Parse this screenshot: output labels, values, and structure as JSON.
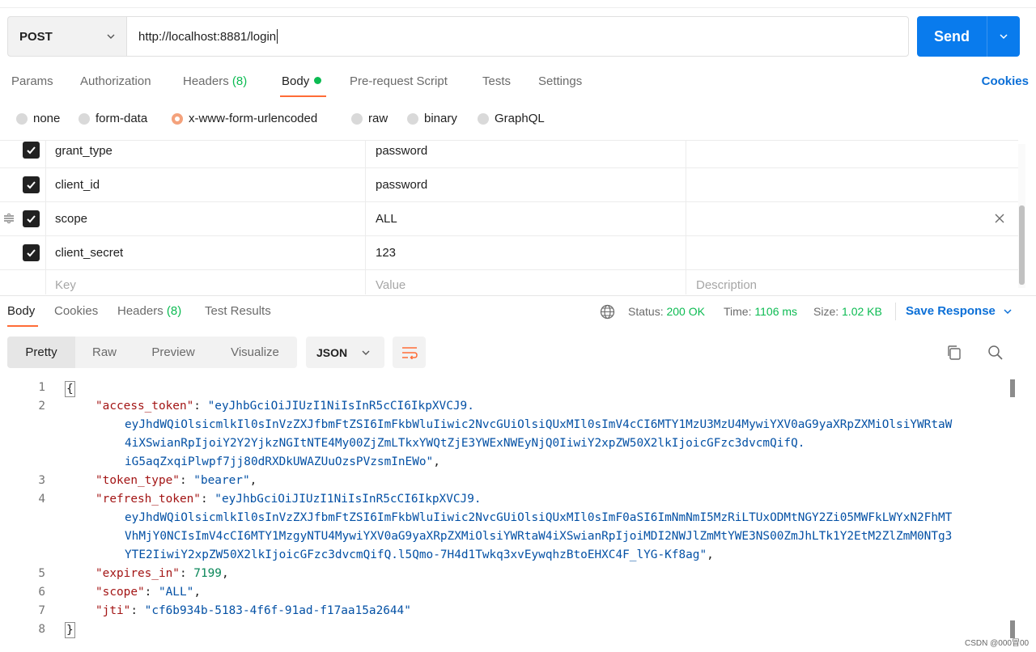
{
  "request": {
    "method": "POST",
    "url": "http://localhost:8881/login",
    "send_label": "Send"
  },
  "request_tabs": {
    "params": "Params",
    "authorization": "Authorization",
    "headers": "Headers",
    "headers_count": "(8)",
    "body": "Body",
    "prerequest": "Pre-request Script",
    "tests": "Tests",
    "settings": "Settings",
    "cookies": "Cookies"
  },
  "body_types": [
    "none",
    "form-data",
    "x-www-form-urlencoded",
    "raw",
    "binary",
    "GraphQL"
  ],
  "body_type_selected": "x-www-form-urlencoded",
  "form_rows": [
    {
      "key": "grant_type",
      "value": "password",
      "checked": true
    },
    {
      "key": "client_id",
      "value": "password",
      "checked": true
    },
    {
      "key": "scope",
      "value": "ALL",
      "checked": true
    },
    {
      "key": "client_secret",
      "value": "123",
      "checked": true
    }
  ],
  "form_placeholders": {
    "key": "Key",
    "value": "Value",
    "description": "Description"
  },
  "response_tabs": {
    "body": "Body",
    "cookies": "Cookies",
    "headers": "Headers",
    "headers_count": "(8)",
    "test_results": "Test Results"
  },
  "response_meta": {
    "status_label": "Status:",
    "status_value": "200 OK",
    "time_label": "Time:",
    "time_value": "1106 ms",
    "size_label": "Size:",
    "size_value": "1.02 KB",
    "save_response": "Save Response"
  },
  "view_modes": [
    "Pretty",
    "Raw",
    "Preview",
    "Visualize"
  ],
  "format": "JSON",
  "code": {
    "line_numbers": [
      "1",
      "2",
      "3",
      "4",
      "5",
      "6",
      "7",
      "8"
    ],
    "open_brace": "{",
    "close_brace": "}",
    "access_token_key": "\"access_token\"",
    "access_token_v1": "\"eyJhbGciOiJIUzI1NiIsInR5cCI6IkpXVCJ9.",
    "access_token_v2": "eyJhdWQiOlsicmlkIl0sInVzZXJfbmFtZSI6ImFkbWluIiwic2NvcGUiOlsiQUxMIl0sImV4cCI6MTY1MzU3MzU4MywiYXV0aG9yaXRpZXMiOlsiYWRtaW",
    "access_token_v3": "4iXSwianRpIjoiY2Y2YjkzNGItNTE4My00ZjZmLTkxYWQtZjE3YWExNWEyNjQ0IiwiY2xpZW50X2lkIjoicGFzc3dvcmQifQ.",
    "access_token_v4": "iG5aqZxqiPlwpf7jj80dRXDkUWAZUuOzsPVzsmInEWo\"",
    "token_type_key": "\"token_type\"",
    "token_type_value": "\"bearer\"",
    "refresh_token_key": "\"refresh_token\"",
    "refresh_token_v1": "\"eyJhbGciOiJIUzI1NiIsInR5cCI6IkpXVCJ9.",
    "refresh_token_v2": "eyJhdWQiOlsicmlkIl0sInVzZXJfbmFtZSI6ImFkbWluIiwic2NvcGUiOlsiQUxMIl0sImF0aSI6ImNmNmI5MzRiLTUxODMtNGY2Zi05MWFkLWYxN2FhMT",
    "refresh_token_v3": "VhMjY0NCIsImV4cCI6MTY1MzgyNTU4MywiYXV0aG9yaXRpZXMiOlsiYWRtaW4iXSwianRpIjoiMDI2NWJlZmMtYWE3NS00ZmJhLTk1Y2EtM2ZlZmM0NTg3",
    "refresh_token_v4": "YTE2IiwiY2xpZW50X2lkIjoicGFzc3dvcmQifQ.l5Qmo-7H4d1Twkq3xvEywqhzBtoEHXC4F_lYG-Kf8ag\"",
    "expires_in_key": "\"expires_in\"",
    "expires_in_value": "7199",
    "scope_key": "\"scope\"",
    "scope_value": "\"ALL\"",
    "jti_key": "\"jti\"",
    "jti_value": "\"cf6b934b-5183-4f6f-91ad-f17aa15a2644\""
  },
  "watermark": "CSDN @000冒00",
  "colors": {
    "send": "#097bed",
    "accent_orange": "#ff6c37",
    "status_green": "#0cbb52",
    "link_blue": "#0b6fd7",
    "json_key": "#a31515",
    "json_string": "#0451a5",
    "json_number": "#098658"
  }
}
